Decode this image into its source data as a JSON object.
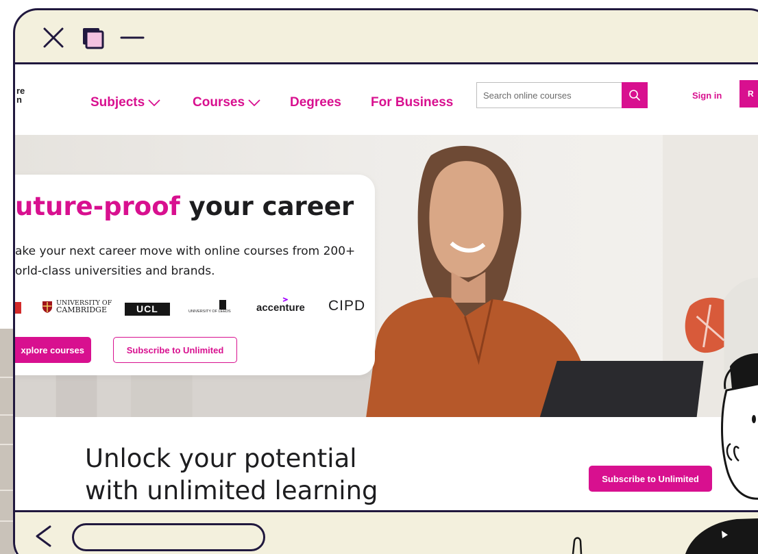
{
  "window": {
    "controls": [
      "close-icon",
      "maximize-icon",
      "minimize-icon"
    ],
    "frame_color": "#20183e",
    "chrome_color": "#f3f0dd"
  },
  "nav": {
    "logo_lines": [
      "re",
      "n"
    ],
    "items": [
      {
        "label": "Subjects",
        "has_dropdown": true
      },
      {
        "label": "Courses",
        "has_dropdown": true
      },
      {
        "label": "Degrees",
        "has_dropdown": false
      },
      {
        "label": "For Business",
        "has_dropdown": false
      }
    ],
    "search_placeholder": "Search online courses",
    "signin_label": "Sign in",
    "register_fragment": "R"
  },
  "hero": {
    "title_accent": "uture-proof",
    "title_rest": "your career",
    "subtitle_line1": "ake your next career move with online courses from 200+",
    "subtitle_line2": "orld-class universities and brands.",
    "partners": {
      "cambridge_line1": "UNIVERSITY OF",
      "cambridge_line2": "CAMBRIDGE",
      "ucl": "UCL",
      "leeds": "UNIVERSITY OF LEEDS",
      "accenture": "accenture",
      "cipd": "CIPD"
    },
    "primary_button": "xplore courses",
    "secondary_button": "Subscribe to Unlimited"
  },
  "unlock": {
    "title_line1": "Unlock your potential",
    "title_line2": "with unlimited learning",
    "button": "Subscribe to Unlimited"
  },
  "colors": {
    "brand_pink": "#d8108f",
    "text_dark": "#1d1d1f"
  }
}
